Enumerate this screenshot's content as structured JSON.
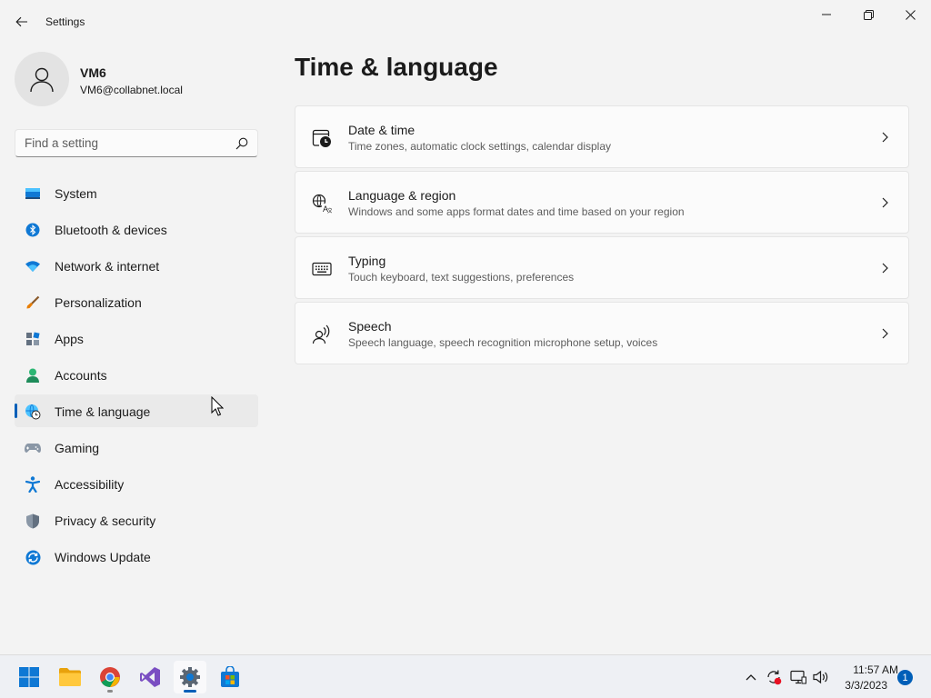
{
  "window": {
    "title": "Settings"
  },
  "profile": {
    "name": "VM6",
    "email": "VM6@collabnet.local"
  },
  "search": {
    "placeholder": "Find a setting"
  },
  "sidebar": {
    "items": [
      {
        "label": "System",
        "icon": "system-icon"
      },
      {
        "label": "Bluetooth & devices",
        "icon": "bluetooth-icon"
      },
      {
        "label": "Network & internet",
        "icon": "wifi-icon"
      },
      {
        "label": "Personalization",
        "icon": "brush-icon"
      },
      {
        "label": "Apps",
        "icon": "apps-icon"
      },
      {
        "label": "Accounts",
        "icon": "person-icon"
      },
      {
        "label": "Time & language",
        "icon": "globe-clock-icon",
        "selected": true
      },
      {
        "label": "Gaming",
        "icon": "gamepad-icon"
      },
      {
        "label": "Accessibility",
        "icon": "accessibility-icon"
      },
      {
        "label": "Privacy & security",
        "icon": "shield-icon"
      },
      {
        "label": "Windows Update",
        "icon": "update-icon"
      }
    ]
  },
  "main": {
    "title": "Time & language",
    "cards": [
      {
        "title": "Date & time",
        "subtitle": "Time zones, automatic clock settings, calendar display",
        "icon": "calendar-clock-icon"
      },
      {
        "title": "Language & region",
        "subtitle": "Windows and some apps format dates and time based on your region",
        "icon": "language-icon"
      },
      {
        "title": "Typing",
        "subtitle": "Touch keyboard, text suggestions, preferences",
        "icon": "keyboard-icon"
      },
      {
        "title": "Speech",
        "subtitle": "Speech language, speech recognition microphone setup, voices",
        "icon": "speech-icon"
      }
    ]
  },
  "taskbar": {
    "apps": [
      "start",
      "file-explorer",
      "chrome",
      "visual-studio",
      "settings",
      "microsoft-store"
    ],
    "active_app": "settings",
    "time": "11:57 AM",
    "date": "3/3/2023",
    "notification_count": "1"
  },
  "colors": {
    "accent": "#005fb8",
    "background": "#f3f3f3",
    "card": "#fbfbfb"
  }
}
